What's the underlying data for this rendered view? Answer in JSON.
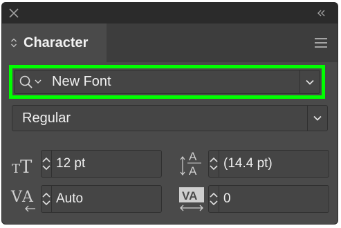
{
  "panel": {
    "tab_label": "Character",
    "close_icon": "close-icon",
    "collapse_icon": "double-chevron-left-icon",
    "menu_icon": "hamburger-menu-icon"
  },
  "font_family": {
    "value": "New Font",
    "search_icon": "search-icon",
    "highlight_color": "#00ff00"
  },
  "font_style": {
    "value": "Regular"
  },
  "metrics": {
    "font_size": {
      "value": "12 pt",
      "icon": "font-size-icon"
    },
    "leading": {
      "value": "(14.4 pt)",
      "icon": "leading-icon"
    },
    "kerning": {
      "value": "Auto",
      "icon": "kerning-icon"
    },
    "tracking": {
      "value": "0",
      "icon": "tracking-icon"
    }
  }
}
